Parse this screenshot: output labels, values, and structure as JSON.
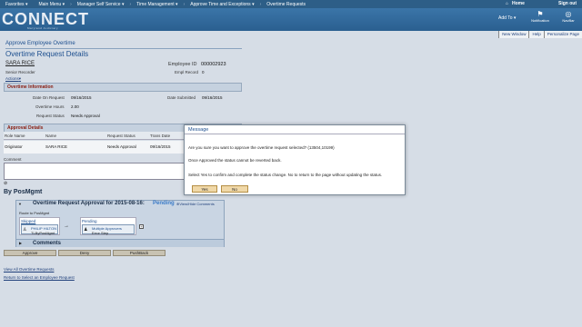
{
  "nav": {
    "items": [
      "Favorites",
      "Main Menu",
      "Manager Self Service",
      "Time Management",
      "Approve Time and Exceptions",
      "Overtime Requests"
    ],
    "home": "Home",
    "signout": "Sign out"
  },
  "banner": {
    "logo": "CONNECT",
    "sub": "Maryland Judiciary",
    "addto": "Add To",
    "notification": "Notification",
    "navbar": "NavBar"
  },
  "util": [
    "New Window",
    "Help",
    "Personalize Page"
  ],
  "page": {
    "title": "Approve Employee Overtime",
    "heading": "Overtime Request Details",
    "emp_name": "SARA RICE",
    "emp_role": "Senior Recorder",
    "actions": "Actions",
    "emp_id_label": "Employee ID",
    "emp_id": "000002923",
    "emp_rec_label": "Empl Record",
    "emp_rec": "0"
  },
  "ot": {
    "section": "Overtime Information",
    "date_on_label": "Date On Request",
    "date_on": "09/16/2015",
    "hours_label": "Overtime Hours",
    "hours": "2.00",
    "status_label": "Request Status",
    "status": "Needs Approval",
    "submitted_label": "Date Submitted",
    "submitted": "09/16/2015"
  },
  "approval_details": {
    "section": "Approval Details",
    "cols": [
      "Role Name",
      "Name",
      "Request Status",
      "Trans Date"
    ],
    "row": [
      "Originator",
      "SARA RICE",
      "Needs Approval",
      "09/16/2015"
    ]
  },
  "comment_label": "Comment",
  "by": "By PosMgmt",
  "chain": {
    "title": "Overtime Request Approval for 2015-08-16:",
    "status": "Pending",
    "view": "View/Hide Comments",
    "route": "Route to PosMgmt",
    "skipped": "Skipped",
    "skipped_name": "PHILIP HILTON",
    "skipped_sub": "TLByPosMgmt",
    "pending": "Pending",
    "pending_name": "Multiple Approvers",
    "pending_sub": "Error Step",
    "comments": "Comments"
  },
  "buttons": {
    "approve": "Approve",
    "deny": "Deny",
    "pushback": "PushBack"
  },
  "links": {
    "view_all": "View All Overtime Requests",
    "return": "Return to Select an Employee Request"
  },
  "dialog": {
    "title": "Message",
    "line1": "Are you sure you want to approve the overtime request selected? (13504,10199)",
    "line2": "Once Approved the status cannot be reverted back.",
    "line3": "Select Yes to confirm and complete the status change. No to return to the page without updating the status.",
    "yes": "Yes",
    "no": "No"
  }
}
